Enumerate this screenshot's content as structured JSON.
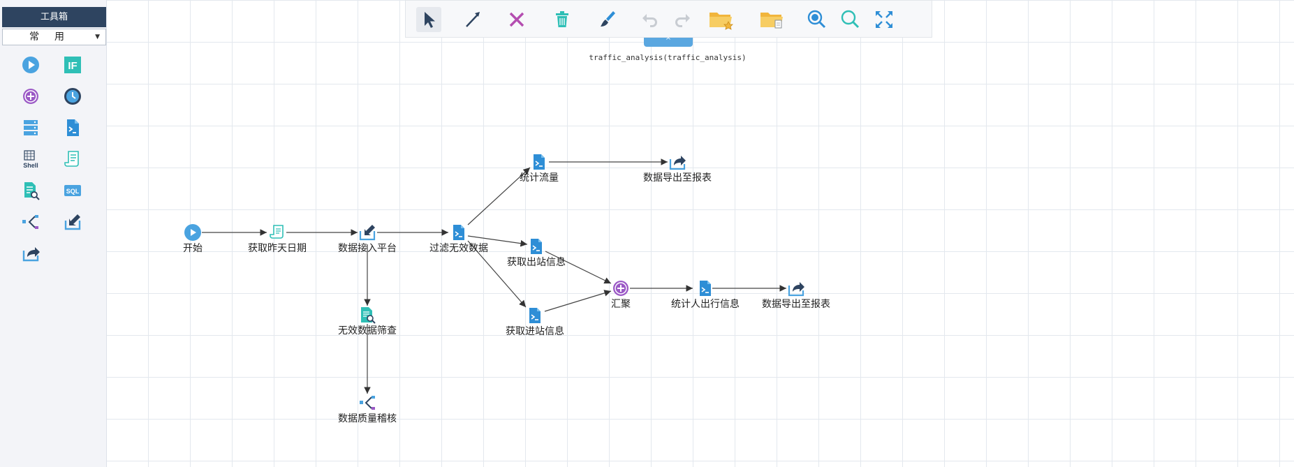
{
  "sidebar": {
    "title": "工具箱",
    "category": "常用",
    "tools": [
      {
        "name": "start-node-tool-icon"
      },
      {
        "name": "if-condition-tool-icon",
        "text": "IF"
      },
      {
        "name": "merge-node-tool-icon"
      },
      {
        "name": "timer-tool-icon"
      },
      {
        "name": "database-tool-icon"
      },
      {
        "name": "script-tool-icon"
      },
      {
        "name": "shell-tool-icon",
        "text": "Shell"
      },
      {
        "name": "scroll-tool-icon"
      },
      {
        "name": "data-inspect-tool-icon"
      },
      {
        "name": "sql-tool-icon",
        "text": "SQL"
      },
      {
        "name": "quality-check-tool-icon"
      },
      {
        "name": "import-tool-icon"
      },
      {
        "name": "export-tool-icon"
      }
    ]
  },
  "toolbar": {
    "buttons": [
      "pointer",
      "connect",
      "delete",
      "trash",
      "clear-brush",
      "undo",
      "redo",
      "open-folder",
      "open-folder-2",
      "zoom-in",
      "zoom-out",
      "fit-screen"
    ]
  },
  "flow": {
    "title": "traffic_analysis(traffic_analysis)",
    "nodes": [
      {
        "id": "start",
        "label": "开始",
        "type": "start"
      },
      {
        "id": "get_date",
        "label": "获取昨天日期",
        "type": "scroll"
      },
      {
        "id": "ingest",
        "label": "数据接入平台",
        "type": "import"
      },
      {
        "id": "filter",
        "label": "过滤无效数据",
        "type": "script"
      },
      {
        "id": "screen",
        "label": "无效数据筛查",
        "type": "inspect"
      },
      {
        "id": "audit",
        "label": "数据质量稽核",
        "type": "quality"
      },
      {
        "id": "flow_stats",
        "label": "统计流量",
        "type": "script"
      },
      {
        "id": "export1",
        "label": "数据导出至报表",
        "type": "export"
      },
      {
        "id": "out_info",
        "label": "获取出站信息",
        "type": "script"
      },
      {
        "id": "in_info",
        "label": "获取进站信息",
        "type": "script"
      },
      {
        "id": "merge",
        "label": "汇聚",
        "type": "merge"
      },
      {
        "id": "trip_stats",
        "label": "统计人出行信息",
        "type": "script"
      },
      {
        "id": "export2",
        "label": "数据导出至报表",
        "type": "export"
      }
    ]
  },
  "colors": {
    "accent": "#4aa3e0",
    "dark": "#2e4460",
    "teal": "#2fbfb6",
    "purple": "#9b59c6",
    "red": "#c0392b"
  }
}
